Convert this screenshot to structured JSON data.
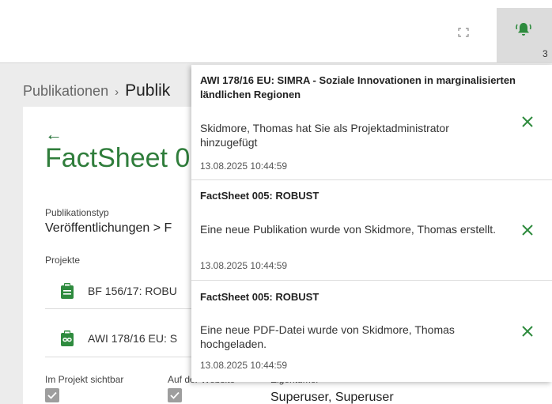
{
  "topbar": {
    "notification_count": "3"
  },
  "breadcrumb": {
    "root": "Publikationen",
    "separator": "›",
    "current": "Publik"
  },
  "page": {
    "title": "FactSheet 0",
    "type_label": "Publikationstyp",
    "type_value": "Veröffentlichungen > F",
    "projects_label": "Projekte",
    "projects": [
      {
        "label": "BF 156/17: ROBU",
        "icon": "clipboard-icon"
      },
      {
        "label": "AWI 178/16 EU: S",
        "icon": "clipboard-link-icon"
      }
    ],
    "visible_in_project_label": "Im Projekt sichtbar",
    "on_website_label": "Auf der Website",
    "owner_label": "Eigentümer",
    "owner_value": "Superuser, Superuser"
  },
  "notifications": [
    {
      "title": "AWI 178/16 EU: SIMRA - Soziale Innovationen in marginalisierten ländlichen Regionen",
      "message": "Skidmore, Thomas hat Sie als Projektadministrator hinzugefügt",
      "time": "13.08.2025 10:44:59"
    },
    {
      "title": "FactSheet 005: ROBUST",
      "message": "Eine neue Publikation wurde von Skidmore, Thomas erstellt.",
      "time": "13.08.2025 10:44:59"
    },
    {
      "title": "FactSheet 005: ROBUST",
      "message": "Eine neue PDF-Datei wurde von Skidmore, Thomas hochgeladen.",
      "time": "13.08.2025 10:44:59"
    }
  ],
  "colors": {
    "accent_green": "#2f7d3b",
    "close_green": "#2e8b3e"
  }
}
